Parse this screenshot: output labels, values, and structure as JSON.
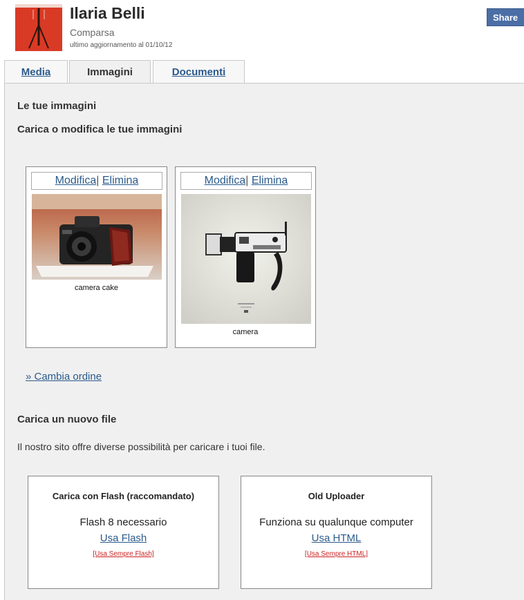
{
  "profile": {
    "name": "Ilaria Belli",
    "role": "Comparsa",
    "updated": "ultimo aggiornamento al 01/10/12"
  },
  "share_label": "Share",
  "tabs": [
    {
      "label": "Media",
      "active": false
    },
    {
      "label": "Immagini",
      "active": true
    },
    {
      "label": "Documenti",
      "active": false
    }
  ],
  "gallery": {
    "heading": "Le tue immagini",
    "subheading": "Carica o modifica le tue immagini",
    "edit_label": "Modifica",
    "separator": "|",
    "delete_label": "Elimina",
    "images": [
      {
        "caption": "camera cake"
      },
      {
        "caption": "camera"
      }
    ],
    "reorder_label": "» Cambia ordine"
  },
  "upload": {
    "heading": "Carica un nuovo file",
    "intro": "Il nostro sito offre diverse possibilità per caricare i tuoi file.",
    "options": [
      {
        "title": "Carica con Flash (raccomandato)",
        "requirement": "Flash 8 necessario",
        "use_label": "Usa Flash",
        "always_label": "[Usa Sempre Flash]"
      },
      {
        "title": "Old Uploader",
        "requirement": "Funziona su qualunque computer",
        "use_label": "Usa HTML",
        "always_label": "[Usa Sempre HTML]"
      }
    ]
  },
  "colors": {
    "link": "#2a5a8c",
    "panel_bg": "#f0f0f0",
    "share_bg": "#4a6ea5",
    "always_link": "#cc2222"
  }
}
